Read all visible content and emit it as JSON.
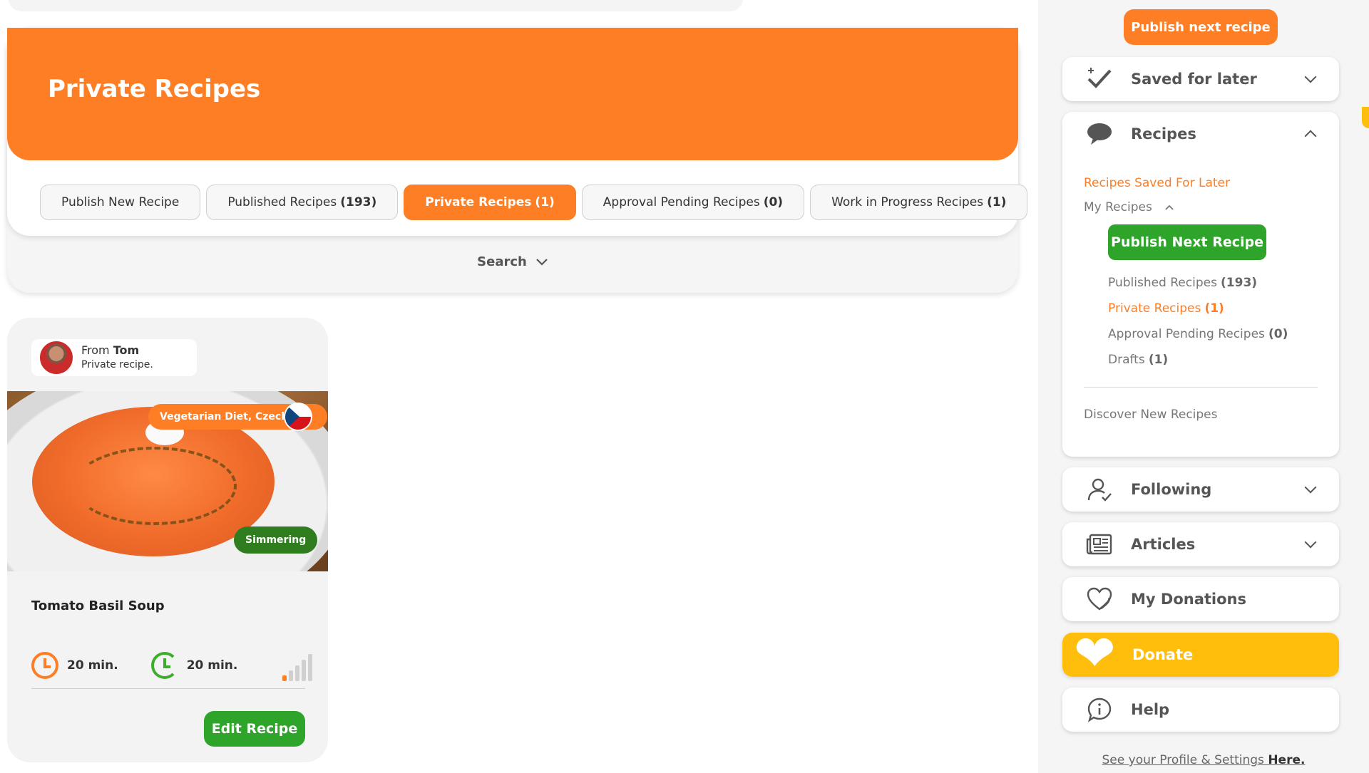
{
  "page": {
    "title": "Private Recipes"
  },
  "tabs": [
    {
      "label": "Publish New Recipe",
      "count": ""
    },
    {
      "label": "Published Recipes",
      "count": "(193)"
    },
    {
      "label": "Private Recipes",
      "count": "(1)"
    },
    {
      "label": "Approval Pending Recipes",
      "count": "(0)"
    },
    {
      "label": "Work in Progress Recipes",
      "count": "(1)"
    }
  ],
  "search": {
    "label": "Search"
  },
  "card": {
    "from_label": "From",
    "author": "Tom",
    "visibility": "Private recipe.",
    "diet_badge": "Vegetarian Diet, Czech",
    "stage_badge": "Simmering",
    "title": "Tomato Basil Soup",
    "prep_time": "20 min.",
    "cook_time": "20 min.",
    "difficulty_level": 1,
    "difficulty_max": 5,
    "edit_label": "Edit Recipe"
  },
  "sidebar": {
    "publish_top": "Publish next recipe",
    "saved": "Saved for later",
    "recipes": "Recipes",
    "recipes_saved_for_later": "Recipes Saved For Later",
    "my_recipes": "My Recipes",
    "publish_next": "Publish Next Recipe",
    "published": {
      "label": "Published Recipes",
      "count": "(193)"
    },
    "private": {
      "label": "Private Recipes",
      "count": "(1)"
    },
    "pending": {
      "label": "Approval Pending Recipes",
      "count": "(0)"
    },
    "drafts": {
      "label": "Drafts",
      "count": "(1)"
    },
    "discover": "Discover New Recipes",
    "following": "Following",
    "articles": "Articles",
    "donations": "My Donations",
    "donate": "Donate",
    "help": "Help",
    "profile_prefix": "See your Profile & Settings",
    "profile_link": "Here."
  },
  "colors": {
    "accent": "#fd7e24",
    "green": "#2ea52a",
    "donate": "#ffbe0b"
  }
}
